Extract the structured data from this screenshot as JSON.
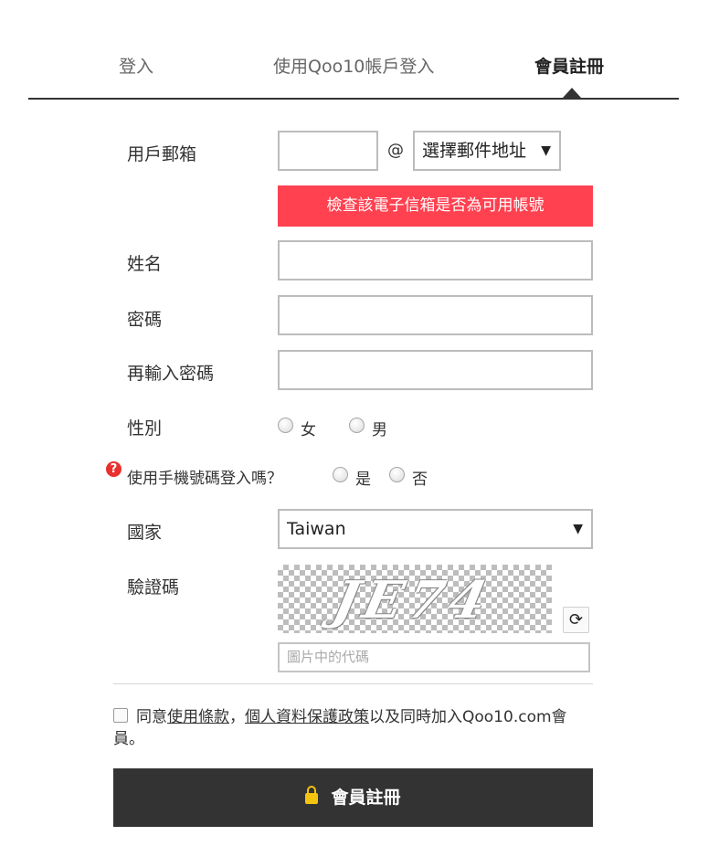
{
  "tabs": {
    "login": "登入",
    "qoo10_login": "使用Qoo10帳戶登入",
    "register": "會員註冊"
  },
  "form": {
    "email_label": "用戶郵箱",
    "at_sign": "@",
    "email_domain_select": "選擇郵件地址",
    "check_email_button": "檢查該電子信箱是否為可用帳號",
    "name_label": "姓名",
    "password_label": "密碼",
    "confirm_password_label": "再輸入密碼",
    "gender_label": "性別",
    "gender_female": "女",
    "gender_male": "男",
    "phone_login_label": "使用手機號碼登入嗎？",
    "phone_yes": "是",
    "phone_no": "否",
    "country_label": "國家",
    "country_value": "Taiwan",
    "captcha_label": "驗證碼",
    "captcha_text": "JE74",
    "captcha_placeholder": "圖片中的代碼"
  },
  "agreement": {
    "prefix": "同意",
    "terms_link": "使用條款",
    "comma": "，",
    "privacy_link": "個人資料保護政策",
    "suffix": "以及同時加入Qoo10.com會員。"
  },
  "submit_label": "會員註冊",
  "icons": {
    "dropdown": "chevron-down-icon",
    "help": "question-icon",
    "refresh": "refresh-icon",
    "lock": "lock-icon"
  },
  "colors": {
    "check_button_bg": "#ff4150",
    "submit_bg": "#333333",
    "lock": "#f2c40f",
    "help_icon": "#e8312f"
  }
}
